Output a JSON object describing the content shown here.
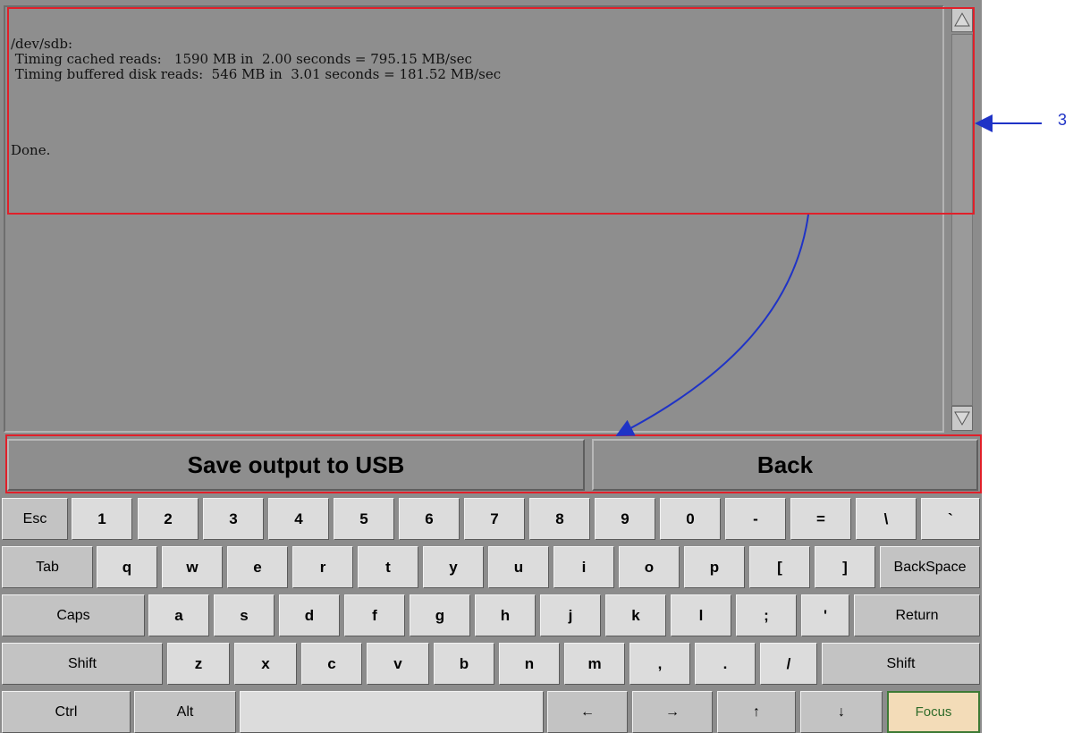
{
  "terminal": {
    "lines": [
      "/dev/sdb:",
      " Timing cached reads:   1590 MB in  2.00 seconds = 795.15 MB/sec",
      " Timing buffered disk reads:  546 MB in  3.01 seconds = 181.52 MB/sec",
      "Done."
    ]
  },
  "actions": {
    "save_label": "Save output to USB",
    "back_label": "Back"
  },
  "keyboard": {
    "row1": [
      "Esc",
      "1",
      "2",
      "3",
      "4",
      "5",
      "6",
      "7",
      "8",
      "9",
      "0",
      "-",
      "=",
      "\\",
      "`"
    ],
    "row2": [
      "Tab",
      "q",
      "w",
      "e",
      "r",
      "t",
      "y",
      "u",
      "i",
      "o",
      "p",
      "[",
      "]",
      "BackSpace"
    ],
    "row3": [
      "Caps",
      "a",
      "s",
      "d",
      "f",
      "g",
      "h",
      "j",
      "k",
      "l",
      ";",
      "'",
      "Return"
    ],
    "row4": [
      "Shift",
      "z",
      "x",
      "c",
      "v",
      "b",
      "n",
      "m",
      ",",
      ".",
      "/",
      "Shift"
    ],
    "row5": [
      "Ctrl",
      "Alt",
      "",
      "←",
      "→",
      "↑",
      "↓",
      "Focus"
    ]
  },
  "annotation": {
    "label": "3"
  },
  "colors": {
    "highlight_box": "#e0202a",
    "arrow": "#1f33c6",
    "focus_key": "#f3dcb8"
  }
}
